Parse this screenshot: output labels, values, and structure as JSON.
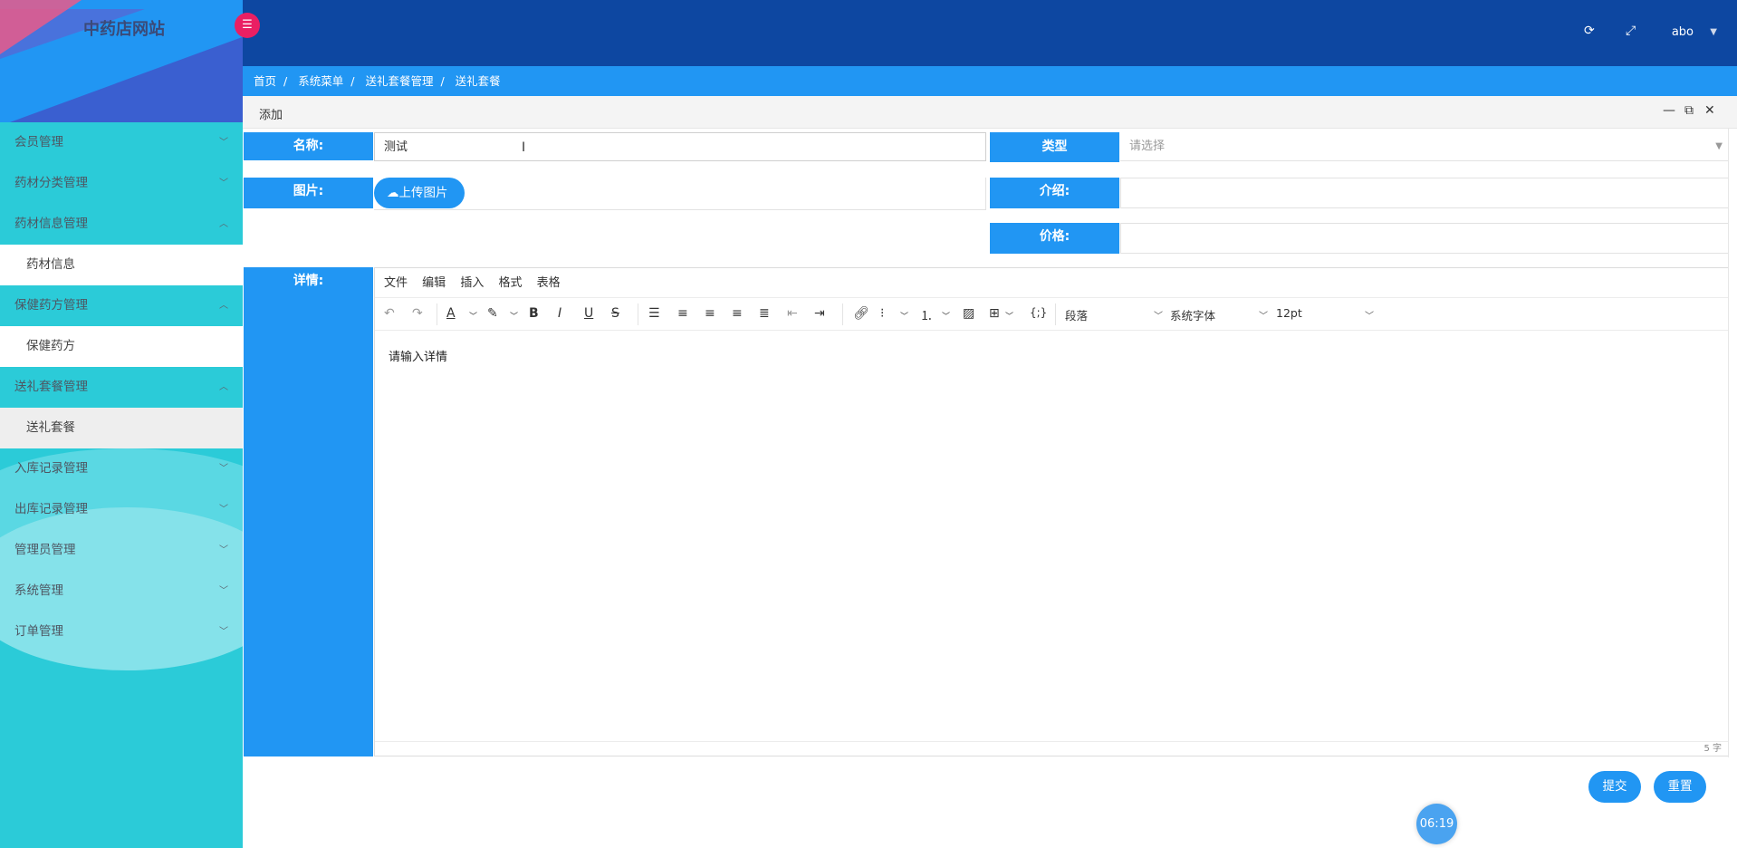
{
  "app": {
    "title": "中药店网站",
    "menu_toggle_icon": "list-icon"
  },
  "topbar": {
    "user": "abo",
    "icons": [
      "refresh-icon",
      "fullscreen-icon"
    ]
  },
  "breadcrumb": [
    "首页",
    "系统菜单",
    "送礼套餐管理",
    "送礼套餐"
  ],
  "sidebar": {
    "items": [
      {
        "label": "会员管理"
      },
      {
        "label": "药材分类管理"
      },
      {
        "label": "药材信息管理",
        "sub": "药材信息"
      },
      {
        "label": "保健药方管理",
        "sub": "保健药方"
      },
      {
        "label": "送礼套餐管理",
        "sub": "送礼套餐"
      },
      {
        "label": "入库记录管理"
      },
      {
        "label": "出库记录管理"
      },
      {
        "label": "管理员管理"
      },
      {
        "label": "系统管理"
      },
      {
        "label": "订单管理"
      }
    ]
  },
  "panel": {
    "title": "添加"
  },
  "form": {
    "name_label": "名称:",
    "name_value": "测试",
    "type_label": "类型",
    "type_placeholder": "请选择",
    "image_label": "图片:",
    "upload_label": "上传图片",
    "intro_label": "介绍:",
    "price_label": "价格:",
    "detail_label": "详情:"
  },
  "editor": {
    "menus": [
      "文件",
      "编辑",
      "插入",
      "格式",
      "表格"
    ],
    "block_format": "段落",
    "font_family": "系统字体",
    "font_size": "12pt",
    "placeholder": "请输入详情",
    "word_count": "5 字"
  },
  "actions": {
    "submit": "提交",
    "reset": "重置"
  },
  "timer": "06:19",
  "colors": {
    "primary": "#2196f3",
    "topbar": "#0d47a1",
    "sidebar": "#2bcbd8",
    "toggle": "#ea1f63"
  }
}
